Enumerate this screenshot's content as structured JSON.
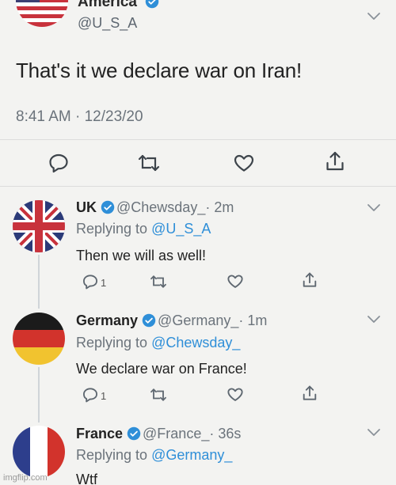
{
  "main_tweet": {
    "name": "America",
    "handle": "@U_S_A",
    "text": "That's it we declare war on Iran!",
    "timestamp": "8:41 AM · 12/23/20",
    "avatar_icon": "usa-flag-avatar",
    "actions": [
      "reply-icon",
      "retweet-icon",
      "like-icon",
      "share-icon"
    ]
  },
  "replies": [
    {
      "name": "UK",
      "handle": "@Chewsday_",
      "age": "· 2m",
      "replying_prefix": "Replying to ",
      "replying_to": "@U_S_A",
      "text": "Then we will as well!",
      "reply_count": "1",
      "avatar_icon": "uk-flag-avatar"
    },
    {
      "name": "Germany",
      "handle": "@Germany_",
      "age": "· 1m",
      "replying_prefix": "Replying to ",
      "replying_to": "@Chewsday_",
      "text": "We declare war on France!",
      "reply_count": "1",
      "avatar_icon": "germany-flag-avatar"
    },
    {
      "name": "France",
      "handle": "@France_",
      "age": "· 36s",
      "replying_prefix": "Replying to ",
      "replying_to": "@Germany_",
      "text": "Wtf",
      "avatar_icon": "france-flag-avatar"
    }
  ],
  "colors": {
    "background": "#f3f3f1",
    "link": "#2f8fd8",
    "verified": "#2f8fd8",
    "icon": "#5e6770"
  },
  "watermark": "imgflip.com"
}
